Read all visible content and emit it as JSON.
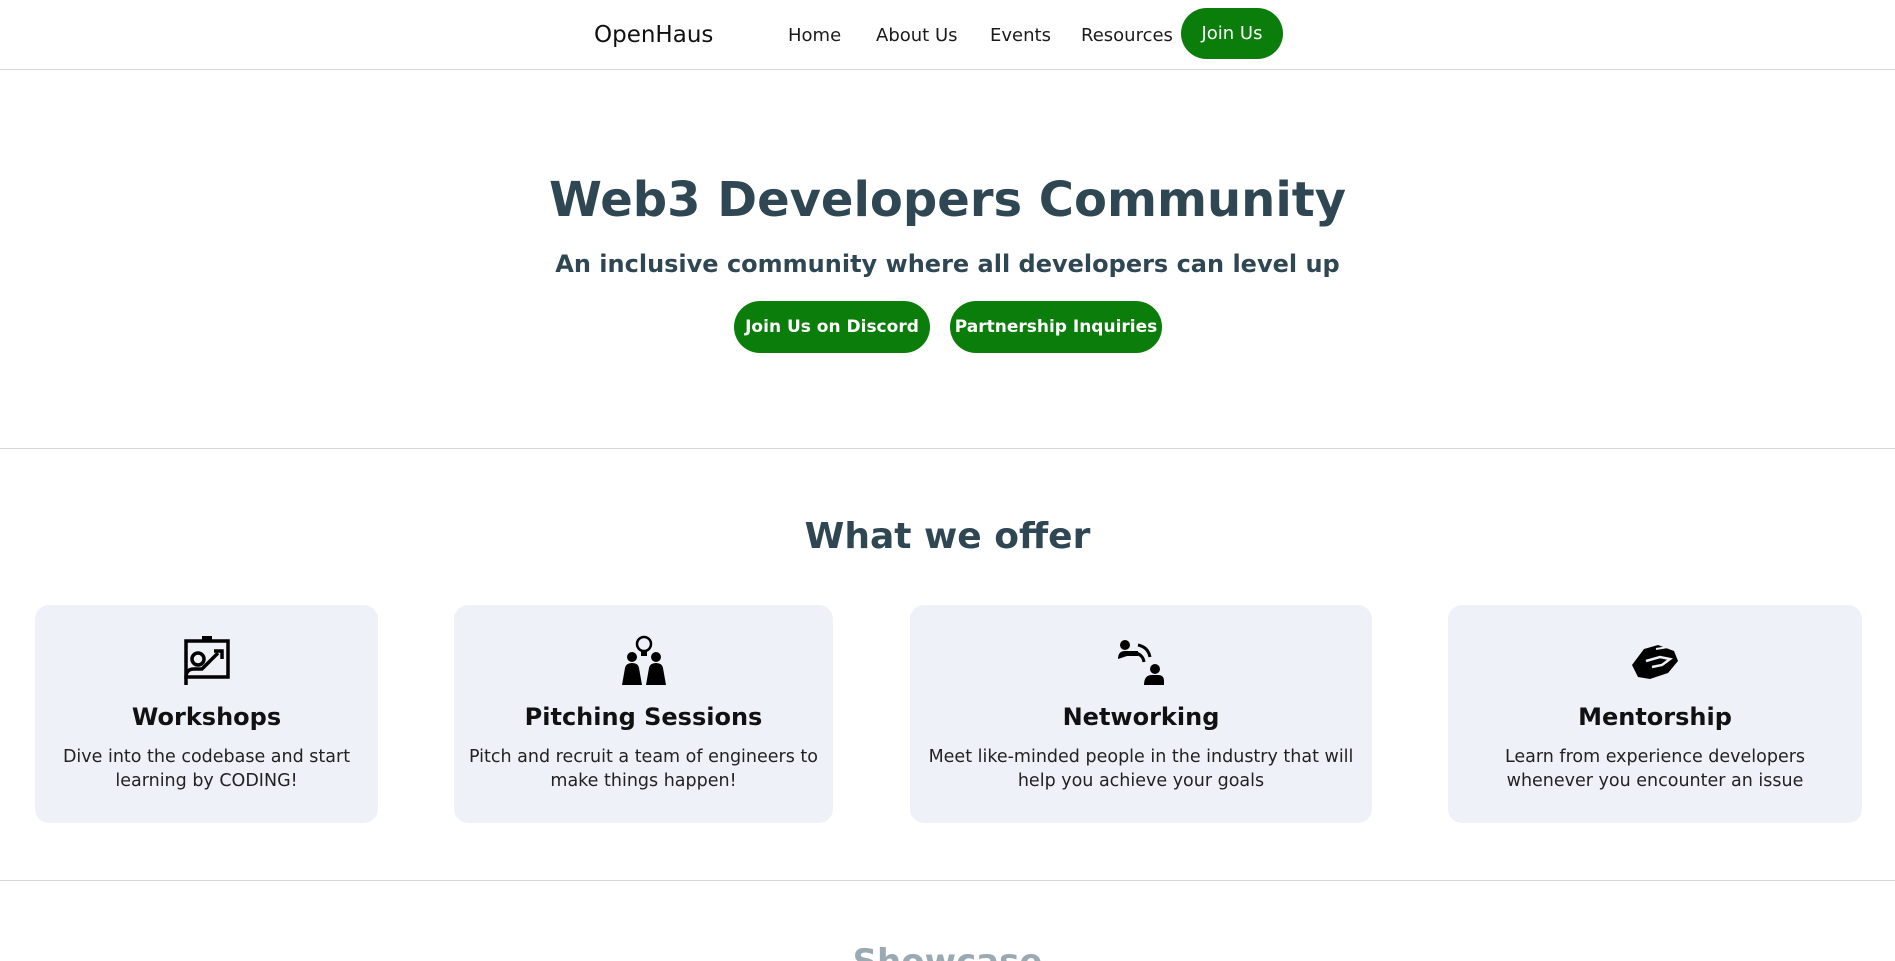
{
  "nav": {
    "brand": "OpenHaus",
    "links": [
      "Home",
      "About Us",
      "Events",
      "Resources"
    ],
    "join_label": "Join Us"
  },
  "hero": {
    "title": "Web3 Developers Community",
    "subtitle": "An inclusive community where all developers can level up",
    "discord_button": "Join Us on Discord",
    "partnership_button": "Partnership Inquiries"
  },
  "offer": {
    "title": "What we offer",
    "cards": [
      {
        "title": "Workshops",
        "desc_line1": "Dive into the codebase and start",
        "desc_line2": "learning by CODING!",
        "icon": "presentation-icon"
      },
      {
        "title": "Pitching Sessions",
        "desc_line1": "Pitch and recruit a team of engineers to",
        "desc_line2": "make things happen!",
        "icon": "pitching-icon"
      },
      {
        "title": "Networking",
        "desc_line1": "Meet like-minded people in the industry that will",
        "desc_line2": "help you achieve your goals",
        "icon": "networking-icon"
      },
      {
        "title": "Mentorship",
        "desc_line1": "Learn from experience developers",
        "desc_line2": "whenever you encounter an issue",
        "icon": "handshake-icon"
      }
    ]
  },
  "showcase": {
    "title": "Showcase"
  },
  "colors": {
    "accent": "#0a7d0a",
    "heading": "#2f4753",
    "card_bg": "#eef1f8"
  }
}
